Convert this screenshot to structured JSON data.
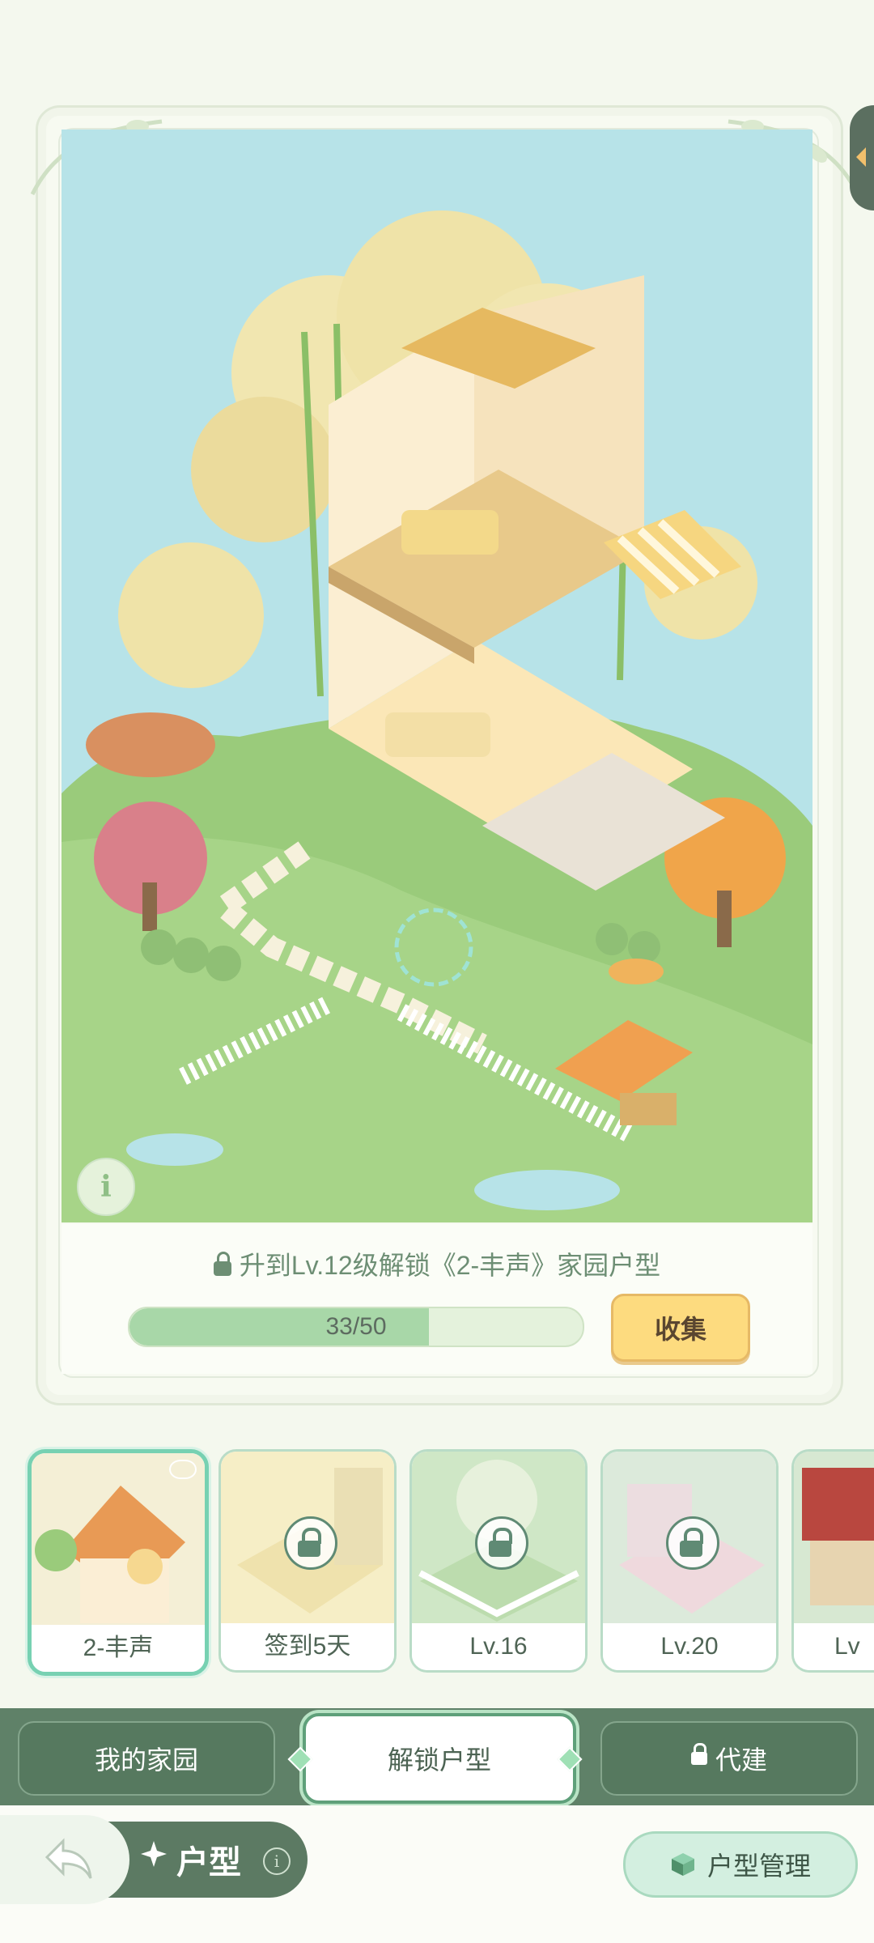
{
  "unlock": {
    "text": "升到Lv.12级解锁《2-丰声》家园户型",
    "progress_label": "33/50",
    "progress_fraction": 0.66,
    "collect_label": "收集"
  },
  "layouts": [
    {
      "label": "2-丰声",
      "locked": false,
      "selected": true
    },
    {
      "label": "签到5天",
      "locked": true,
      "selected": false
    },
    {
      "label": "Lv.16",
      "locked": true,
      "selected": false
    },
    {
      "label": "Lv.20",
      "locked": true,
      "selected": false
    },
    {
      "label": "Lv",
      "locked": true,
      "selected": false
    }
  ],
  "tabs": {
    "my_home": "我的家园",
    "unlock_layout": "解锁户型",
    "proxy_build": "代建"
  },
  "footer": {
    "title": "户型",
    "manage_label": "户型管理"
  },
  "colors": {
    "accent": "#5f8168",
    "collect": "#fddb7f",
    "progress": "#a8d7a8"
  }
}
